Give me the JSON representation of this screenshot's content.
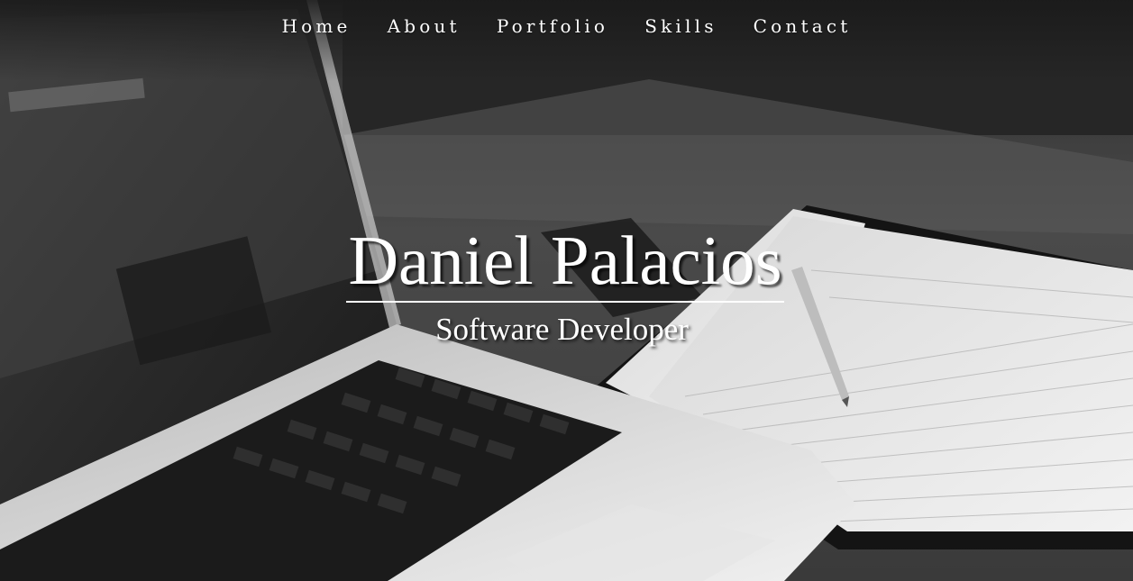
{
  "nav": {
    "items": [
      {
        "label": "Home"
      },
      {
        "label": "About"
      },
      {
        "label": "Portfolio"
      },
      {
        "label": "Skills"
      },
      {
        "label": "Contact"
      }
    ]
  },
  "hero": {
    "name": "Daniel Palacios",
    "role": "Software Developer",
    "background_image": "laptop-notebook-pen-desk-photo"
  },
  "colors": {
    "text": "#ffffff",
    "background_dark": "#2a2a2a",
    "paper": "#e8e8e8"
  }
}
